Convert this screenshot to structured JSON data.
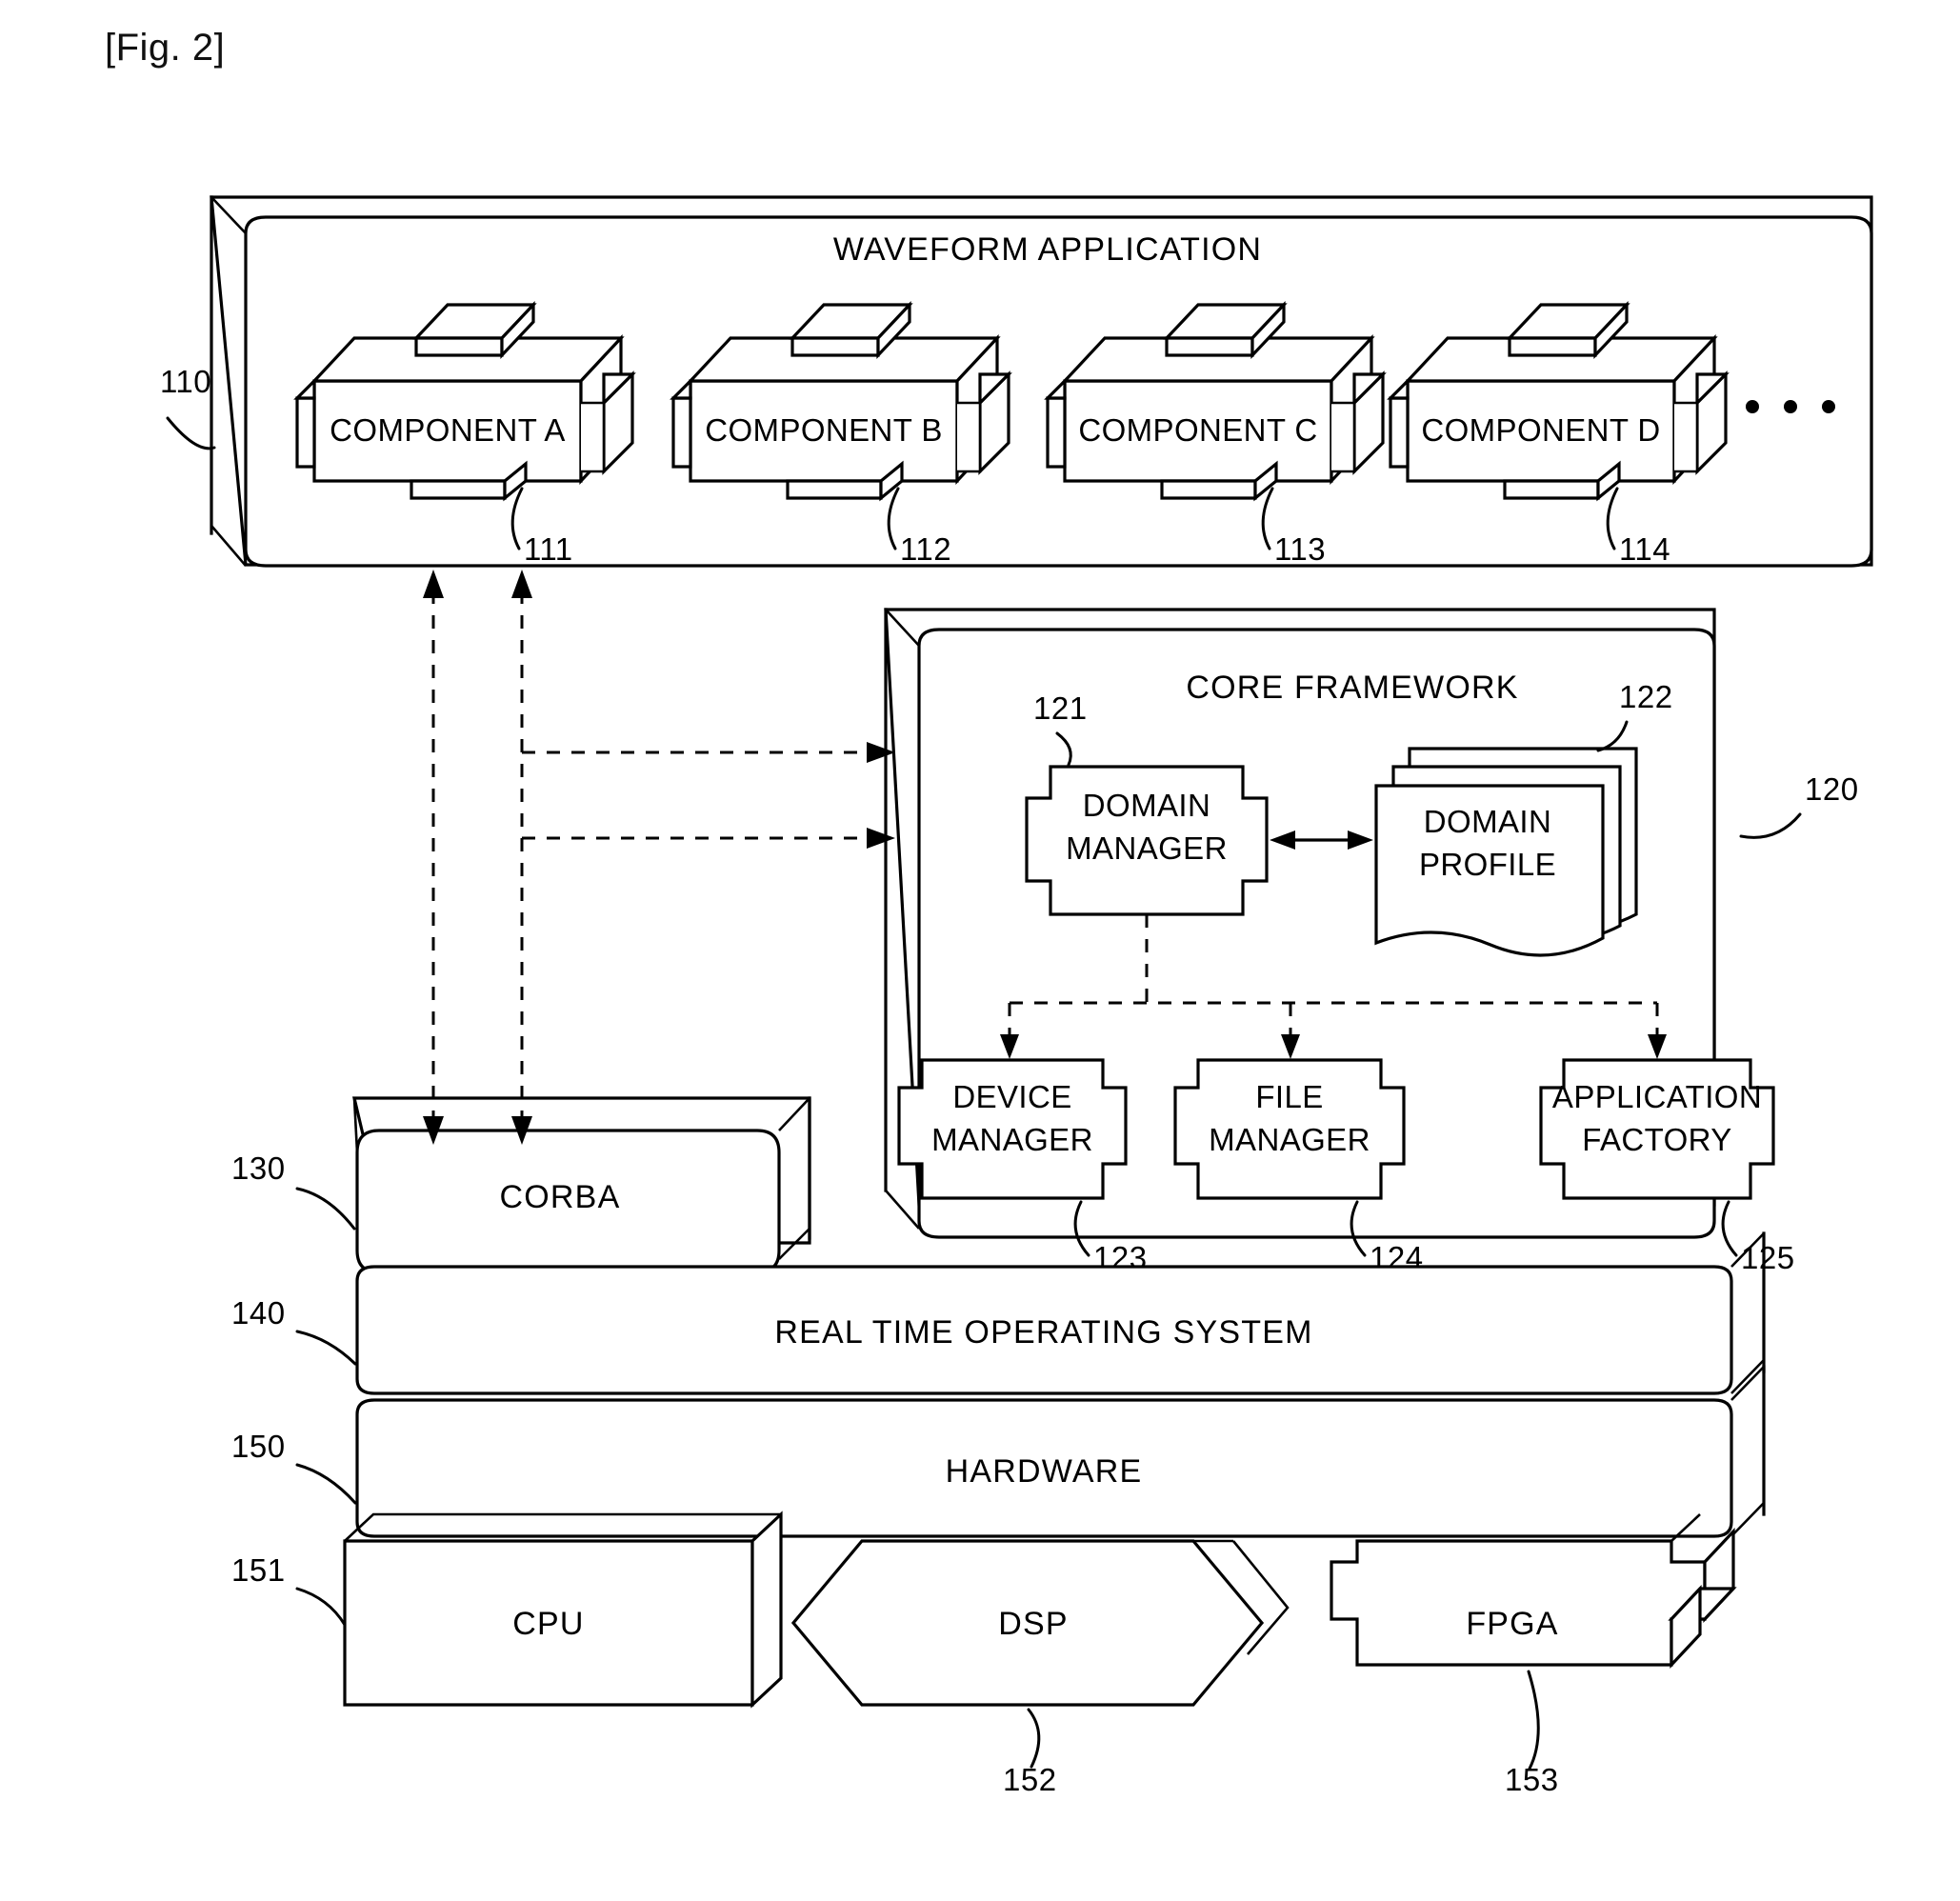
{
  "figure": {
    "label": "[Fig. 2]"
  },
  "layers": {
    "waveform_application": {
      "title": "WAVEFORM APPLICATION",
      "ref": "110",
      "components": [
        {
          "label": "COMPONENT A",
          "ref": "111"
        },
        {
          "label": "COMPONENT B",
          "ref": "112"
        },
        {
          "label": "COMPONENT C",
          "ref": "113"
        },
        {
          "label": "COMPONENT D",
          "ref": "114"
        }
      ],
      "ellipsis": "• • •"
    },
    "core_framework": {
      "title": "CORE FRAMEWORK",
      "ref": "120",
      "blocks": [
        {
          "label_line1": "DOMAIN",
          "label_line2": "MANAGER",
          "ref": "121",
          "shape": "puzzle"
        },
        {
          "label_line1": "DOMAIN",
          "label_line2": "PROFILE",
          "ref": "122",
          "shape": "document-stack"
        },
        {
          "label_line1": "DEVICE",
          "label_line2": "MANAGER",
          "ref": "123",
          "shape": "puzzle"
        },
        {
          "label_line1": "FILE",
          "label_line2": "MANAGER",
          "ref": "124",
          "shape": "puzzle"
        },
        {
          "label_line1": "APPLICATION",
          "label_line2": "FACTORY",
          "ref": "125",
          "shape": "puzzle"
        }
      ]
    },
    "corba": {
      "title": "CORBA",
      "ref": "130"
    },
    "rtos": {
      "title": "REAL TIME OPERATING SYSTEM",
      "ref": "140"
    },
    "hardware": {
      "title": "HARDWARE",
      "ref": "150",
      "devices": [
        {
          "label": "CPU",
          "ref": "151",
          "shape": "box3d"
        },
        {
          "label": "DSP",
          "ref": "152",
          "shape": "hexagon"
        },
        {
          "label": "FPGA",
          "ref": "153",
          "shape": "puzzle3d"
        }
      ]
    }
  }
}
